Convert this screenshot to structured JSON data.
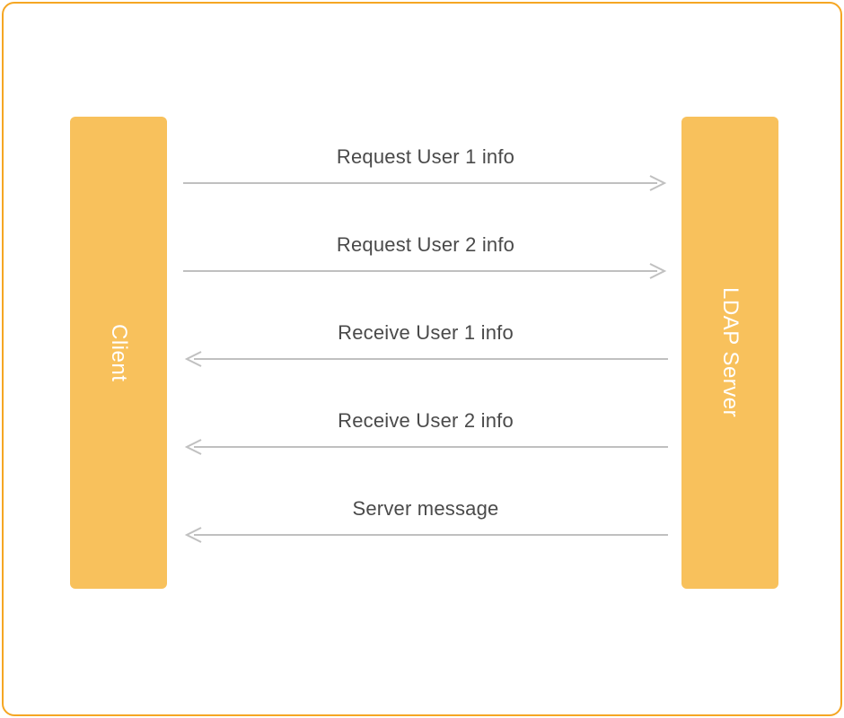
{
  "colors": {
    "frame": "#f5a623",
    "box_fill": "#f8c15c",
    "box_text": "#ffffff",
    "arrow": "#c0c0c0",
    "label": "#4a4a4a"
  },
  "left_box": {
    "label": "Client"
  },
  "right_box": {
    "label": "LDAP Server"
  },
  "messages": [
    {
      "label": "Request User 1 info",
      "direction": "right"
    },
    {
      "label": "Request User 2 info",
      "direction": "right"
    },
    {
      "label": "Receive User 1 info",
      "direction": "left"
    },
    {
      "label": "Receive User 2 info",
      "direction": "left"
    },
    {
      "label": "Server message",
      "direction": "left"
    }
  ]
}
